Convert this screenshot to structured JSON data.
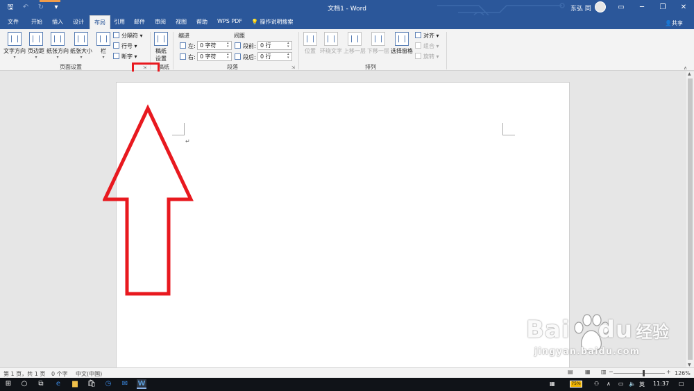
{
  "titlebar": {
    "title": "文档1 - Word",
    "user": "东弘 同",
    "qat": {
      "save": "🖫",
      "undo": "↶",
      "redo": "↻",
      "customize": "▾"
    },
    "buttons": {
      "ribbon_display": "▭",
      "minimize": "─",
      "restore": "❐",
      "close": "✕"
    }
  },
  "tabs": {
    "items": [
      "文件",
      "开始",
      "插入",
      "设计",
      "布局",
      "引用",
      "邮件",
      "审阅",
      "视图",
      "帮助",
      "WPS PDF"
    ],
    "active": "布局",
    "tell_me": "操作说明搜索",
    "share": "共享"
  },
  "ribbon": {
    "page_setup": {
      "label": "页面设置",
      "text_direction": "文字方向",
      "margins": "页边距",
      "orientation": "纸张方向",
      "size": "纸张大小",
      "columns": "栏",
      "breaks": "分隔符 ▾",
      "line_numbers": "行号 ▾",
      "hyphenation": "断字 ▾"
    },
    "manuscript": {
      "label": "稿纸",
      "button_line1": "稿纸",
      "button_line2": "设置"
    },
    "paragraph": {
      "label": "段落",
      "indent_header": "缩进",
      "spacing_header": "间距",
      "left_label": "左:",
      "left_value": "0 字符",
      "right_label": "右:",
      "right_value": "0 字符",
      "before_label": "段前:",
      "before_value": "0 行",
      "after_label": "段后:",
      "after_value": "0 行"
    },
    "arrange": {
      "label": "排列",
      "position": "位置",
      "wrap_text": "环绕文字",
      "bring_forward": "上移一层",
      "send_backward": "下移一层",
      "selection_pane": "选择窗格",
      "align": "对齐 ▾",
      "group": "组合 ▾",
      "rotate": "旋转 ▾"
    }
  },
  "document": {
    "paragraph_mark": "↵"
  },
  "statusbar": {
    "page": "第 1 页，共 1 页",
    "words": "0 个字",
    "language": "中文(中国)",
    "zoom_minus": "−",
    "zoom_plus": "+",
    "zoom": "126%"
  },
  "taskbar": {
    "battery": "75%",
    "ime": "英",
    "time": "11:37"
  },
  "watermark": {
    "brand_latin": "Bai",
    "brand_latin2": "du",
    "brand_cn": "经验",
    "url": "jingyan.baidu.com"
  },
  "colors": {
    "word_blue": "#2b579a",
    "highlight_red": "#e8191f"
  }
}
